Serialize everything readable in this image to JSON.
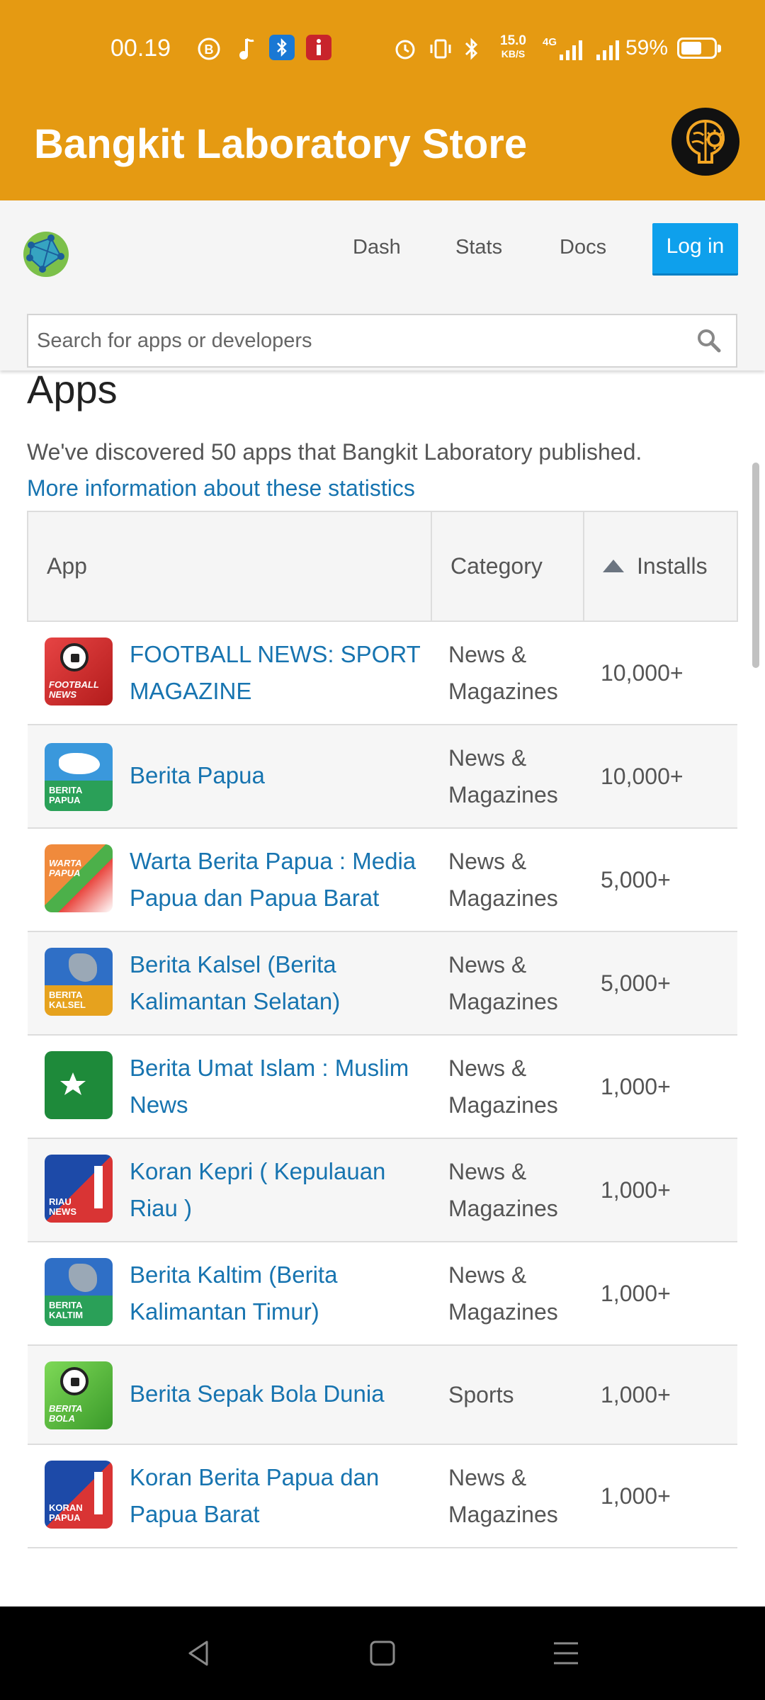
{
  "status_bar": {
    "time": "00.19",
    "network_speed_top": "15.0",
    "network_speed_unit": "KB/S",
    "network_type": "4G",
    "battery_percent": "59%",
    "icons": [
      "b-circle-icon",
      "music-note-icon",
      "bluetooth-app-icon",
      "info-app-icon",
      "alarm-icon",
      "vibrate-icon",
      "bluetooth-icon",
      "signal-icon",
      "battery-icon"
    ]
  },
  "app_header": {
    "title": "Bangkit Laboratory Store",
    "icon": "brain-gear-icon"
  },
  "navbar": {
    "logo": "globe-logo-icon",
    "links": [
      "Dash",
      "Stats",
      "Docs"
    ],
    "login_label": "Log in"
  },
  "search": {
    "placeholder": "Search for apps or developers",
    "icon": "search-icon"
  },
  "main": {
    "heading": "Apps",
    "intro": "We've discovered 50 apps that Bangkit Laboratory published.",
    "more_link": "More information about these statistics"
  },
  "table": {
    "headers": {
      "app": "App",
      "category": "Category",
      "installs": "Installs"
    },
    "rows": [
      {
        "name": "FOOTBALL NEWS: SPORT MAGAZINE",
        "category": "News & Magazines",
        "installs": "10,000+"
      },
      {
        "name": "Berita Papua",
        "category": "News & Magazines",
        "installs": "10,000+"
      },
      {
        "name": "Warta Berita Papua : Media Papua dan Papua Barat",
        "category": "News & Magazines",
        "installs": "5,000+"
      },
      {
        "name": "Berita Kalsel (Berita Kalimantan Selatan)",
        "category": "News & Magazines",
        "installs": "5,000+"
      },
      {
        "name": "Berita Umat Islam : Muslim News",
        "category": "News & Magazines",
        "installs": "1,000+"
      },
      {
        "name": "Koran Kepri ( Kepulauan Riau )",
        "category": "News & Magazines",
        "installs": "1,000+"
      },
      {
        "name": "Berita Kaltim (Berita Kalimantan Timur)",
        "category": "News & Magazines",
        "installs": "1,000+"
      },
      {
        "name": "Berita Sepak Bola Dunia",
        "category": "Sports",
        "installs": "1,000+"
      },
      {
        "name": "Koran Berita Papua dan Papua Barat",
        "category": "News & Magazines",
        "installs": "1,000+"
      }
    ]
  },
  "system_nav": {
    "icons": [
      "back-icon",
      "home-icon",
      "recents-icon"
    ]
  }
}
